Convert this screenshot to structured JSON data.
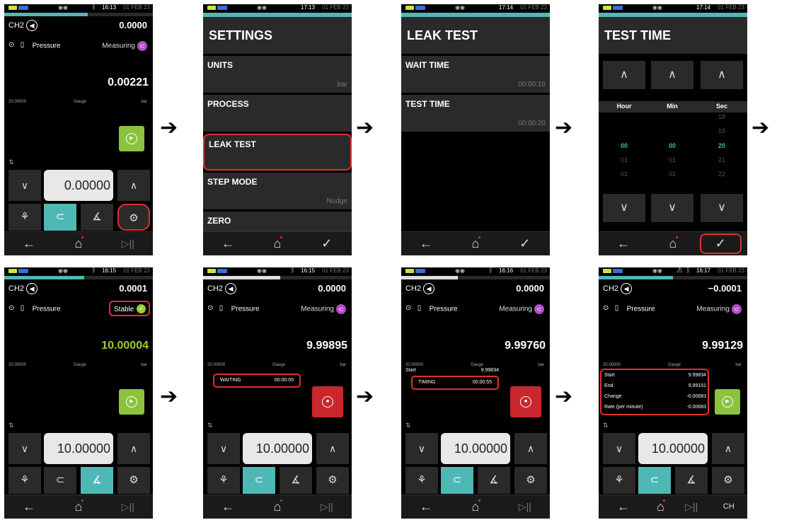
{
  "status": {
    "date": "01 FEB 23"
  },
  "nav": {
    "back": "←",
    "home": "⌂",
    "playpause": "▷||",
    "ch": "CH"
  },
  "chevrons": {
    "up": "∧",
    "down": "∨"
  },
  "arrow": "➔",
  "icons": {
    "fan": "⚘",
    "pump": "⊂",
    "leak": "∡",
    "gear": "⚙",
    "play": "▶",
    "stop": "■",
    "check": "✓",
    "swap": "⇅"
  },
  "s1": {
    "time": "16:13",
    "ch": "CH2",
    "top": "0.0000",
    "sensor": "Pressure",
    "status": "Measuring",
    "reading": "0.00221",
    "range": "20.00000",
    "gauge": "Gauge",
    "unit": "bar",
    "setpoint": "0.00000"
  },
  "s2": {
    "time": "17:13",
    "title": "SETTINGS",
    "rows": [
      {
        "label": "UNITS",
        "value": "bar"
      },
      {
        "label": "PROCESS",
        "value": ""
      },
      {
        "label": "LEAK TEST",
        "value": ""
      },
      {
        "label": "STEP MODE",
        "value": "Nudge"
      },
      {
        "label": "ZERO",
        "value": ""
      }
    ]
  },
  "s3": {
    "time": "17:14",
    "title": "LEAK TEST",
    "rows": [
      {
        "label": "WAIT TIME",
        "value": "00:00:10"
      },
      {
        "label": "TEST TIME",
        "value": "00:00:20"
      }
    ]
  },
  "s4": {
    "time": "17:14",
    "title": "TEST TIME",
    "cols": [
      "Hour",
      "Min",
      "Sec"
    ],
    "hour": [
      "00",
      "01",
      "02"
    ],
    "min": [
      "00",
      "01",
      "02"
    ],
    "sec": [
      "18",
      "19",
      "20",
      "21",
      "22"
    ]
  },
  "s5": {
    "time": "16:15",
    "ch": "CH2",
    "top": "0.0001",
    "sensor": "Pressure",
    "status": "Stable",
    "reading": "10.00004",
    "range": "20.00000",
    "gauge": "Gauge",
    "unit": "bar",
    "setpoint": "10.00000"
  },
  "s6": {
    "time": "16:15",
    "ch": "CH2",
    "top": "0.0000",
    "sensor": "Pressure",
    "status": "Measuring",
    "reading": "9.99895",
    "range": "20.00000",
    "gauge": "Gauge",
    "unit": "bar",
    "wait_label": "WAITING",
    "wait_time": "00:00:05",
    "setpoint": "10.00000"
  },
  "s7": {
    "time": "16:16",
    "ch": "CH2",
    "top": "0.0000",
    "sensor": "Pressure",
    "status": "Measuring",
    "reading": "9.99760",
    "range": "20.00000",
    "gauge": "Gauge",
    "unit": "bar",
    "start_label": "Start",
    "start_value": "9.99834",
    "timing_label": "TIMING",
    "timing_time": "00:00:55",
    "setpoint": "10.00000"
  },
  "s8": {
    "time": "16:17",
    "ch": "CH2",
    "top": "−0.0001",
    "sensor": "Pressure",
    "status": "Measuring",
    "reading": "9.99129",
    "range": "20.00000",
    "gauge": "Gauge",
    "unit": "bar",
    "results": [
      {
        "label": "Start",
        "value": "9.99834"
      },
      {
        "label": "End",
        "value": "9.99151"
      },
      {
        "label": "Change",
        "value": "-0.00683"
      },
      {
        "label": "Rate (per minute)",
        "value": "-0.00683"
      }
    ],
    "setpoint": "10.00000"
  }
}
